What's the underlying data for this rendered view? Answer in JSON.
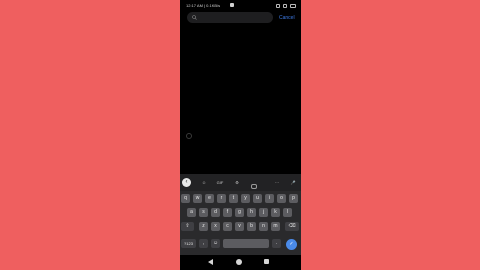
{
  "status_bar": {
    "time": "12:17 AM | 0.1KB/s",
    "alarm_icon": "alarm-icon",
    "wifi_icon": "wifi-icon",
    "battery_icon": "battery-icon"
  },
  "search": {
    "placeholder": "",
    "cancel_label": "Cancel"
  },
  "keyboard": {
    "suggestion_bar": {
      "expand_label": "‹",
      "items": [
        "☺",
        "GIF",
        "⚙",
        "⋯",
        "🎤"
      ]
    },
    "rows": [
      [
        "q",
        "w",
        "e",
        "r",
        "t",
        "y",
        "u",
        "i",
        "o",
        "p"
      ],
      [
        "a",
        "s",
        "d",
        "f",
        "g",
        "h",
        "j",
        "k",
        "l"
      ],
      [
        "z",
        "x",
        "c",
        "v",
        "b",
        "n",
        "m"
      ]
    ],
    "shift_label": "⇧",
    "backspace_label": "⌫",
    "symbols_label": "?123",
    "comma_label": ",",
    "emoji_label": "☺",
    "period_label": ".",
    "enter_label": "✓"
  },
  "colors": {
    "background": "#ef5f5f",
    "screen": "#000000",
    "accent": "#3e7ce8",
    "key": "#5c5c60"
  }
}
